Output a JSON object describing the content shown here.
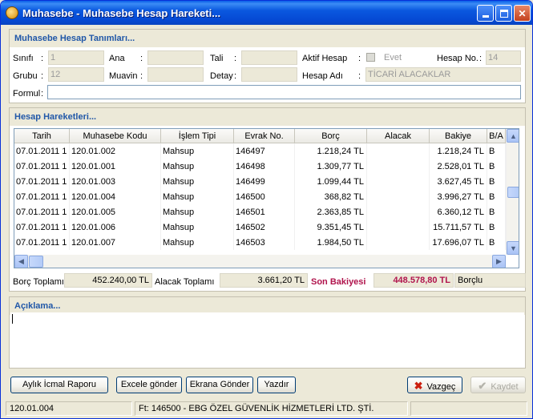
{
  "window": {
    "title": "Muhasebe - Muhasebe Hesap Hareketi..."
  },
  "definitions": {
    "title": "Muhasebe Hesap Tanımları...",
    "sinifi_label": "Sınıfı",
    "sinifi_value": "1",
    "grubu_label": "Grubu",
    "grubu_value": "12",
    "ana_label": "Ana",
    "ana_value": "",
    "muavin_label": "Muavin",
    "muavin_value": "",
    "tali_label": "Tali",
    "tali_value": "",
    "detay_label": "Detay",
    "detay_value": "",
    "aktif_label": "Aktif Hesap",
    "aktif_checkbox_text": "Evet",
    "hesap_no_label": "Hesap No.",
    "hesap_no_value": "14",
    "hesap_adi_label": "Hesap Adı",
    "hesap_adi_value": "TİCARİ ALACAKLAR",
    "formul_label": "Formul",
    "formul_value": "",
    "colon": ":"
  },
  "movements": {
    "title": "Hesap Hareketleri...",
    "columns": [
      "Tarih",
      "Muhasebe Kodu",
      "İşlem Tipi",
      "Evrak No.",
      "Borç",
      "Alacak",
      "Bakiye",
      "B/A"
    ],
    "rows": [
      [
        "07.01.2011 1",
        "120.01.002",
        "Mahsup",
        "146497",
        "1.218,24 TL",
        "",
        "1.218,24 TL",
        "B"
      ],
      [
        "07.01.2011 1",
        "120.01.001",
        "Mahsup",
        "146498",
        "1.309,77 TL",
        "",
        "2.528,01 TL",
        "B"
      ],
      [
        "07.01.2011 1",
        "120.01.003",
        "Mahsup",
        "146499",
        "1.099,44 TL",
        "",
        "3.627,45 TL",
        "B"
      ],
      [
        "07.01.2011 1",
        "120.01.004",
        "Mahsup",
        "146500",
        "368,82 TL",
        "",
        "3.996,27 TL",
        "B"
      ],
      [
        "07.01.2011 1",
        "120.01.005",
        "Mahsup",
        "146501",
        "2.363,85 TL",
        "",
        "6.360,12 TL",
        "B"
      ],
      [
        "07.01.2011 1",
        "120.01.006",
        "Mahsup",
        "146502",
        "9.351,45 TL",
        "",
        "15.711,57 TL",
        "B"
      ],
      [
        "07.01.2011 1",
        "120.01.007",
        "Mahsup",
        "146503",
        "1.984,50 TL",
        "",
        "17.696,07 TL",
        "B"
      ]
    ]
  },
  "totals": {
    "borc_label": "Borç Toplamı",
    "borc_value": "452.240,00 TL",
    "alacak_label": "Alacak Toplamı",
    "alacak_value": "3.661,20 TL",
    "son_bakiye_label": "Son Bakiyesi",
    "son_bakiye_value": "448.578,80 TL",
    "state_value": "Borçlu",
    "highlight_color": "#b0134c"
  },
  "description": {
    "title": "Açıklama...",
    "value": ""
  },
  "buttons": {
    "aylik_icmal": "Aylık İcmal Raporu",
    "excel": "Excele gönder",
    "ekran": "Ekrana Gönder",
    "yazdir": "Yazdır",
    "vazgec": "Vazgeç",
    "kaydet": "Kaydet"
  },
  "status": {
    "account_code": "120.01.004",
    "document_info": "Ft: 146500 - EBG ÖZEL GÜVENLİK HİZMETLERİ LTD. ŞTİ.",
    "extra": ""
  },
  "icons": {
    "app": "app-icon",
    "minimize": "minimize-icon",
    "maximize": "maximize-icon",
    "close": "close-icon",
    "cancel": "x-icon",
    "save": "checkmark-icon"
  }
}
